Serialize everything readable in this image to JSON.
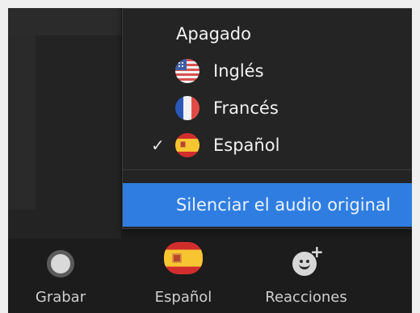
{
  "menu": {
    "items": [
      {
        "label": "Apagado"
      },
      {
        "label": "Inglés",
        "icon": "us-flag-icon"
      },
      {
        "label": "Francés",
        "icon": "france-flag-icon"
      },
      {
        "label": "Español",
        "icon": "spain-flag-icon",
        "checked": true
      }
    ],
    "mute_original_audio": "Silenciar el audio original"
  },
  "toolbar": {
    "items": [
      {
        "label": "Grabar",
        "icon": "record-icon"
      },
      {
        "label": "Español",
        "icon": "spain-flag-icon"
      },
      {
        "label": "Reacciones",
        "icon": "reaction-add-icon"
      }
    ]
  },
  "colors": {
    "menu_background": "#242424",
    "highlight": "#2f7de1",
    "toolbar_background": "#1c1c1c",
    "text": "#f2f2f2"
  },
  "icons": {
    "checkmark": "checkmark-icon"
  }
}
